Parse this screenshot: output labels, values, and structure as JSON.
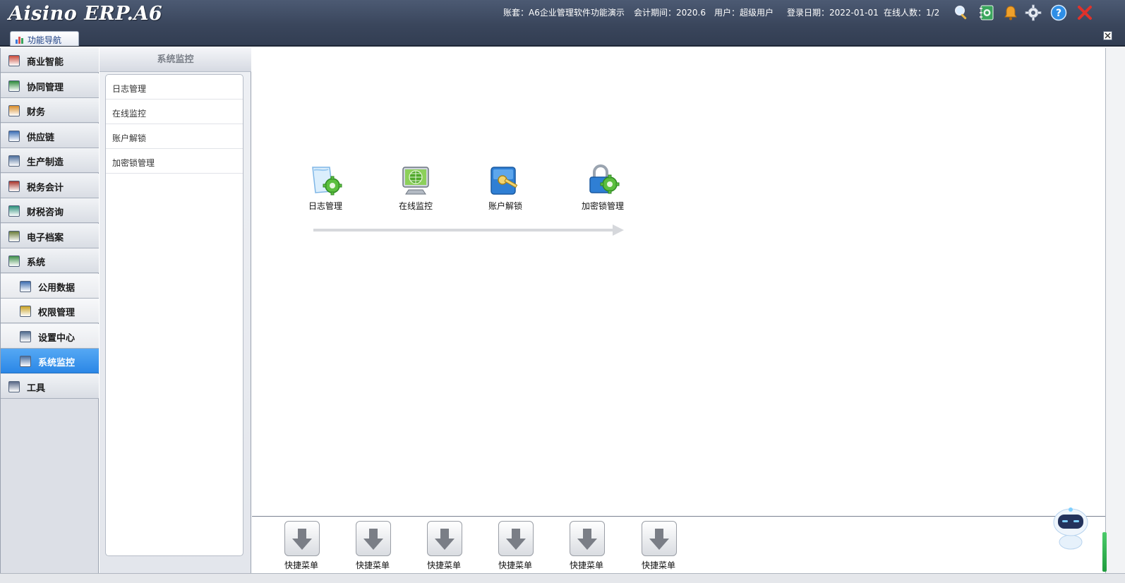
{
  "app": {
    "logo_text": "Aisino ERP.A6"
  },
  "header": {
    "account": "账套：A6企业管理软件功能演示",
    "period": "会计期间：2020.6",
    "user": "用户：超级用户",
    "login_date": "登录日期：2022-01-01",
    "online": "在线人数：1/2",
    "icons": [
      "search-icon",
      "notebook-icon",
      "bell-icon",
      "gear-icon",
      "help-icon",
      "close-icon"
    ]
  },
  "tabs": [
    {
      "label": "功能导航",
      "icon": "chart-icon"
    }
  ],
  "sidebar": {
    "items": [
      {
        "label": "商业智能",
        "icon": "business-intelligence-icon",
        "color": "#c94a3a",
        "sub": false,
        "active": false
      },
      {
        "label": "协同管理",
        "icon": "collaboration-icon",
        "color": "#2e8b3b",
        "sub": false,
        "active": false
      },
      {
        "label": "财务",
        "icon": "finance-icon",
        "color": "#d98d2b",
        "sub": false,
        "active": false
      },
      {
        "label": "供应链",
        "icon": "supply-chain-icon",
        "color": "#3b6fb6",
        "sub": false,
        "active": false
      },
      {
        "label": "生产制造",
        "icon": "manufacturing-icon",
        "color": "#4c6e9c",
        "sub": false,
        "active": false
      },
      {
        "label": "税务会计",
        "icon": "tax-accounting-icon",
        "color": "#a8342c",
        "sub": false,
        "active": false
      },
      {
        "label": "财税咨询",
        "icon": "tax-consulting-icon",
        "color": "#2c8f7a",
        "sub": false,
        "active": false
      },
      {
        "label": "电子档案",
        "icon": "archive-icon",
        "color": "#6b7d3a",
        "sub": false,
        "active": false
      },
      {
        "label": "系统",
        "icon": "system-icon",
        "color": "#3f8f4b",
        "sub": false,
        "active": false
      },
      {
        "label": "公用数据",
        "icon": "common-data-icon",
        "color": "#3d6db0",
        "sub": true,
        "active": false
      },
      {
        "label": "权限管理",
        "icon": "permission-icon",
        "color": "#c8a123",
        "sub": true,
        "active": false
      },
      {
        "label": "设置中心",
        "icon": "settings-center-icon",
        "color": "#4f6b8f",
        "sub": true,
        "active": false
      },
      {
        "label": "系统监控",
        "icon": "system-monitor-icon",
        "color": "#4a6fa0",
        "sub": true,
        "active": true
      },
      {
        "label": "工具",
        "icon": "tools-icon",
        "color": "#5a6a88",
        "sub": false,
        "active": false
      }
    ]
  },
  "panel": {
    "title": "系统监控",
    "items": [
      "日志管理",
      "在线监控",
      "账户解锁",
      "加密锁管理"
    ]
  },
  "main": {
    "functions": [
      {
        "label": "日志管理",
        "icon": "log-management-icon"
      },
      {
        "label": "在线监控",
        "icon": "online-monitor-icon"
      },
      {
        "label": "账户解锁",
        "icon": "account-unlock-icon"
      },
      {
        "label": "加密锁管理",
        "icon": "dongle-management-icon"
      }
    ]
  },
  "quick_menu": {
    "items": [
      "快捷菜单",
      "快捷菜单",
      "快捷菜单",
      "快捷菜单",
      "快捷菜单",
      "快捷菜单"
    ]
  },
  "colors": {
    "accent": "#2b87e6",
    "header": "#3a465c"
  }
}
